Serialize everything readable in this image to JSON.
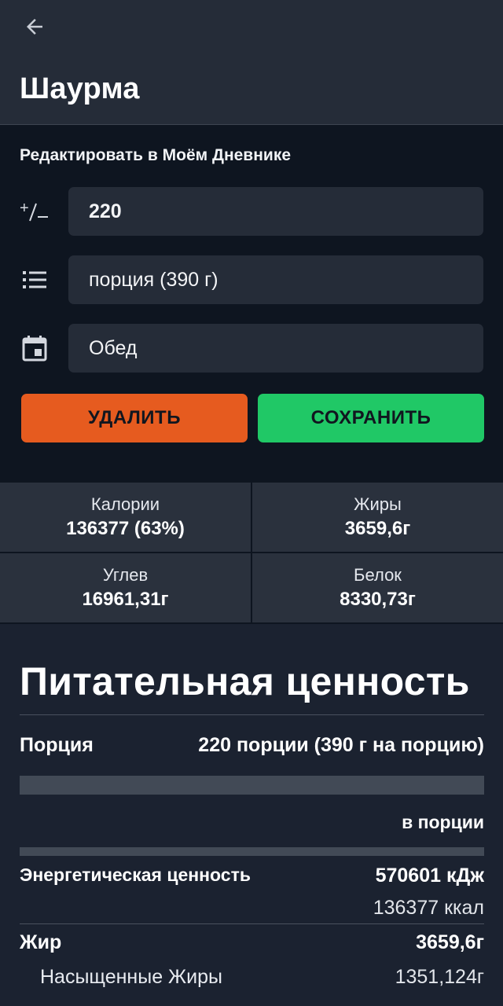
{
  "header": {
    "title": "Шаурма",
    "back_icon": "arrow-left-icon"
  },
  "edit": {
    "title": "Редактировать в Моём Дневнике",
    "quantity_icon": "plus-minus-icon",
    "quantity_value": "220",
    "unit_icon": "list-icon",
    "unit_value": "порция (390 г)",
    "meal_icon": "calendar-icon",
    "meal_value": "Обед",
    "delete_label": "УДАЛИТЬ",
    "save_label": "СОХРАНИТЬ",
    "delete_color": "#e65b1f",
    "save_color": "#20c866"
  },
  "stats": {
    "calories": {
      "label": "Калории",
      "value": "136377 (63%)"
    },
    "fat": {
      "label": "Жиры",
      "value": "3659,6г"
    },
    "carbs": {
      "label": "Углев",
      "value": "16961,31г"
    },
    "protein": {
      "label": "Белок",
      "value": "8330,73г"
    }
  },
  "nutrition": {
    "title": "Питательная ценность",
    "serving_label": "Порция",
    "serving_value": "220 порции (390 г на порцию)",
    "per_serving_label": "в порции",
    "energy_label": "Энергетическая ценность",
    "energy_kj": "570601 кДж",
    "energy_kcal": "136377 ккал",
    "fat_label": "Жир",
    "fat_value": "3659,6г",
    "sat_fat_label": "Насыщенные Жиры",
    "sat_fat_value": "1351,124г"
  }
}
